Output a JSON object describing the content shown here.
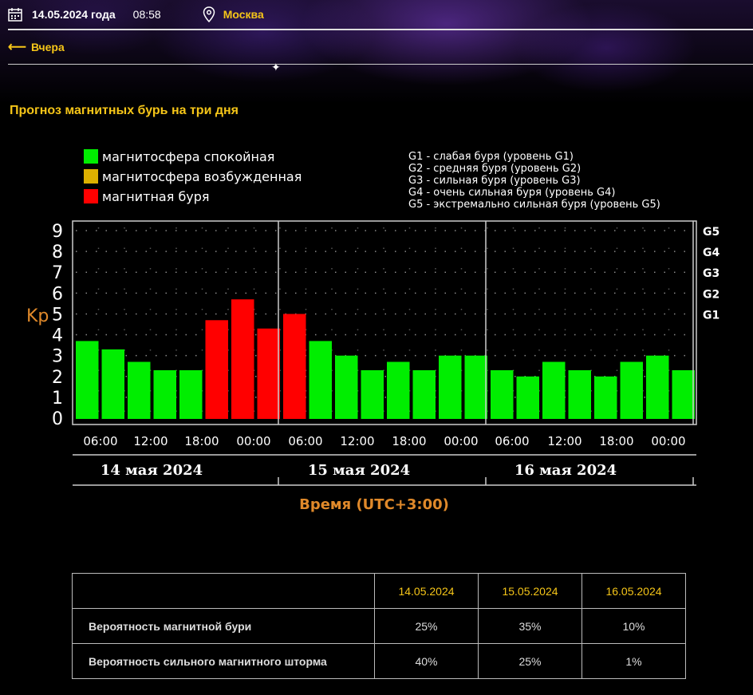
{
  "header": {
    "date": "14.05.2024 года",
    "time": "08:58",
    "city": "Москва",
    "calendar_icon": "calendar-icon",
    "location_icon": "map-pin-icon"
  },
  "nav": {
    "back_label": "Вчера",
    "back_icon": "arrow-left-icon"
  },
  "page_title": "Прогноз магнитных бурь на три дня",
  "chart_data": {
    "type": "bar",
    "ylabel": "Kp",
    "xlabel": "Время (UTC+3:00)",
    "ylim": [
      0,
      9
    ],
    "grid": true,
    "legend_placement": "top-left",
    "legend": [
      {
        "label": "магнитосфера спокойная",
        "color": "#00ee00"
      },
      {
        "label": "магнитосфера возбужденная",
        "color": "#ddb000"
      },
      {
        "label": "магнитная буря",
        "color": "#ff0000"
      }
    ],
    "g_legend": [
      "G1 - слабая буря (уровень G1)",
      "G2 - средняя буря (уровень G2)",
      "G3 - сильная буря (уровень G3)",
      "G4 - очень сильная буря (уровень G4)",
      "G5 - экстремально сильная буря (уровень G5)"
    ],
    "y_ticks": [
      "0",
      "1",
      "2",
      "3",
      "4",
      "5",
      "6",
      "7",
      "8",
      "9"
    ],
    "g_ticks": [
      {
        "label": "G1",
        "value": 5
      },
      {
        "label": "G2",
        "value": 6
      },
      {
        "label": "G3",
        "value": 7
      },
      {
        "label": "G4",
        "value": 8
      },
      {
        "label": "G5",
        "value": 9
      }
    ],
    "x_ticks": [
      "06:00",
      "12:00",
      "18:00",
      "00:00",
      "06:00",
      "12:00",
      "18:00",
      "00:00",
      "06:00",
      "12:00",
      "18:00",
      "00:00",
      "00:00"
    ],
    "days": [
      "14 мая 2024",
      "15 мая 2024",
      "16 мая 2024"
    ],
    "values": [
      3.7,
      3.3,
      2.7,
      2.3,
      2.3,
      4.7,
      5.7,
      4.3,
      5.0,
      3.7,
      3.0,
      2.3,
      2.7,
      2.3,
      3.0,
      3.0,
      2.3,
      2.0,
      2.7,
      2.3,
      2.0,
      2.7,
      3.0,
      2.3
    ],
    "statuses": [
      "quiet",
      "quiet",
      "quiet",
      "quiet",
      "quiet",
      "storm",
      "storm",
      "storm",
      "storm",
      "quiet",
      "quiet",
      "quiet",
      "quiet",
      "quiet",
      "quiet",
      "quiet",
      "quiet",
      "quiet",
      "quiet",
      "quiet",
      "quiet",
      "quiet",
      "quiet",
      "quiet"
    ]
  },
  "table": {
    "headers": [
      "",
      "14.05.2024",
      "15.05.2024",
      "16.05.2024"
    ],
    "rows": [
      {
        "label": "Вероятность магнитной бури",
        "values": [
          "25%",
          "35%",
          "10%"
        ]
      },
      {
        "label": "Вероятность сильного магнитного шторма",
        "values": [
          "40%",
          "25%",
          "1%"
        ]
      }
    ]
  }
}
